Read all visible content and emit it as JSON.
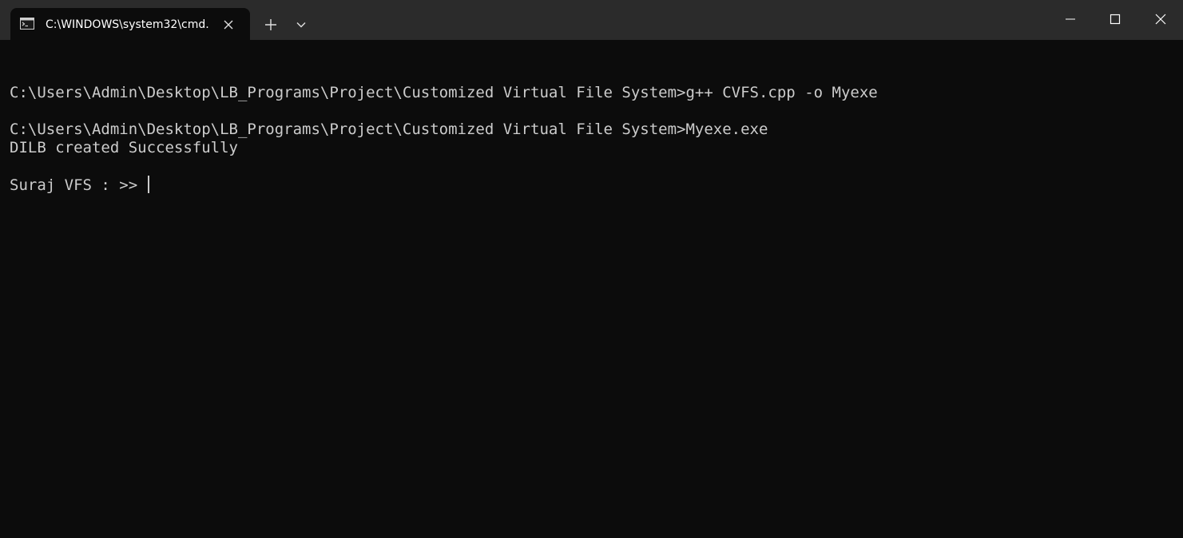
{
  "tab": {
    "title": "C:\\WINDOWS\\system32\\cmd.",
    "icon": "cmd-icon"
  },
  "icons": {
    "close_tab": "close-icon",
    "new_tab": "plus-icon",
    "dropdown": "chevron-down-icon",
    "minimize": "minimize-icon",
    "maximize": "maximize-icon",
    "close_window": "close-icon"
  },
  "terminal": {
    "lines": [
      "",
      "C:\\Users\\Admin\\Desktop\\LB_Programs\\Project\\Customized Virtual File System>g++ CVFS.cpp -o Myexe",
      "",
      "C:\\Users\\Admin\\Desktop\\LB_Programs\\Project\\Customized Virtual File System>Myexe.exe",
      "DILB created Successfully",
      "",
      "Suraj VFS : >> "
    ]
  },
  "colors": {
    "background": "#0c0c0c",
    "titlebar": "#2b2b2b",
    "text": "#cccccc"
  }
}
